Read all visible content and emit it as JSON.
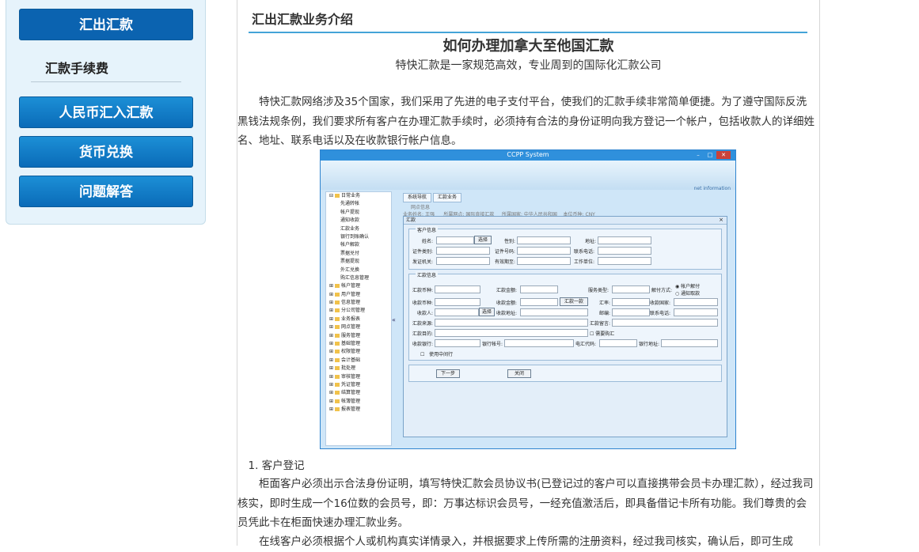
{
  "sidebar": {
    "active_item": "汇出汇款",
    "sub_item": "汇款手续费",
    "items": [
      "人民币汇入汇款",
      "货币兑换",
      "问题解答"
    ]
  },
  "main": {
    "section_title": "汇出汇款业务介绍",
    "article_title": "如何办理加拿大至他国汇款",
    "article_subtitle": "特快汇款是一家规范高效，专业周到的国际化汇款公司",
    "intro": "　　特快汇款网络涉及35个国家，我们采用了先进的电子支付平台，使我们的汇款手续非常简单便捷。为了遵守国际反洗黑钱法规条例，我们要求所有客户在办理汇款手续时，必须持有合法的身份证明向我方登记一个帐户，包括收款人的详细姓名、地址、联系电话以及在收款银行帐户信息。",
    "step1_heading": "　1. 客户登记",
    "step1_text": "　　柜面客户必须出示合法身份证明，填写特快汇款会员协议书(已登记过的客户可以直接携带会员卡办理汇款），经过我司核实，即时生成一个16位数的会员号，即：万事达标识会员号，一经充值激活后，即具备借记卡所有功能。我们尊贵的会员凭此卡在柜面快速办理汇款业务。",
    "step1_text2": "　　在线客户必须根据个人或机构真实详情录入，并根据要求上传所需的注册资料，经过我司核实，确认后，即可生成"
  },
  "screenshot": {
    "window_title": "CCPP System",
    "banner_text": "net information",
    "tabs": [
      "系统导航",
      "汇款业务"
    ],
    "tree_root": "日常业务",
    "tree_children": [
      "先通转帐",
      "帐户提现",
      "通知收款",
      "汇款业务",
      "银行到账确认",
      "帐户解款",
      "票据兑付",
      "票据提现",
      "外汇兑换",
      "购汇信息管理"
    ],
    "tree_parents": [
      "帐户管理",
      "用户管理",
      "信息管理",
      "分公司管理",
      "业务报表",
      "网点管理",
      "服务管理",
      "基础管理",
      "权限管理",
      "会计基础",
      "批处理",
      "审核管理",
      "凭证管理",
      "结算管理",
      "帐簿管理",
      "报表管理"
    ],
    "dialog_title": "汇款",
    "customer_group": "客户信息",
    "remit_group": "汇款信息",
    "customer_labels": [
      "姓名:",
      "性别:",
      "地址:",
      "证件类别:",
      "证件号码:",
      "联系电话:",
      "发证机关:",
      "有效期至:",
      "工作单位:"
    ],
    "remit_labels": [
      "汇款币种:",
      "汇款金额:",
      "服务类型:",
      "解付方式:",
      "收款币种:",
      "收款金额:",
      "汇率:",
      "收款国家:",
      "收款人:",
      "收款地址:",
      "邮编:",
      "联系电话:",
      "汇款来源:",
      "汇款留言:",
      "汇款目的:",
      "收款银行:",
      "银行帐号:",
      "电汇代码:",
      "银行地址:"
    ],
    "radio_options": [
      "帐户解付",
      "通知取款"
    ],
    "checkbox_need": "需要购汇",
    "checkbox_intermediary": "使用中间行",
    "select_button": "选择",
    "remit_one_button": "汇款一款",
    "next_button": "下一步",
    "close_button": "关闭",
    "background_row": "网点信息",
    "background_labels": [
      "业务姓名:",
      "王强",
      "所属网点:",
      "国际直接汇款",
      "所属国家:",
      "中华人民共和国",
      "本位币种:",
      "CNY"
    ]
  }
}
